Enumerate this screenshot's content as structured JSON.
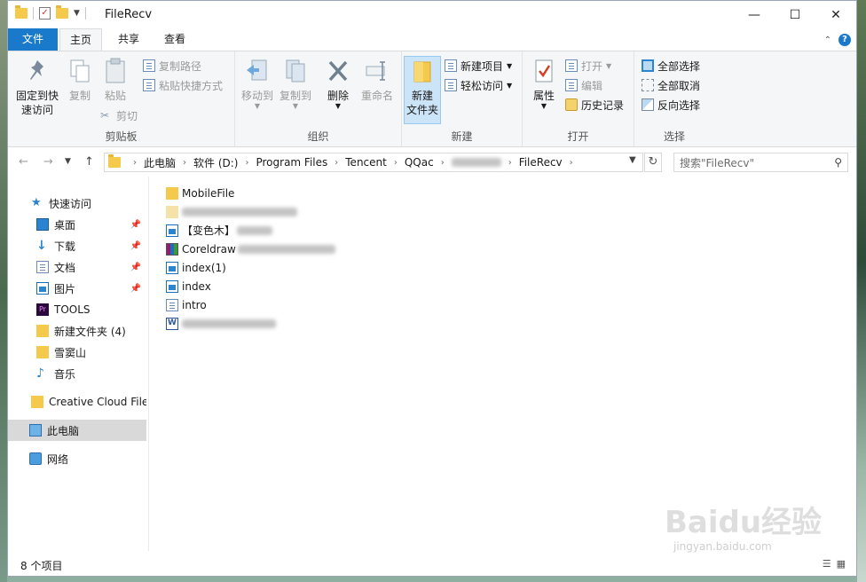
{
  "window": {
    "title": "FileRecv",
    "controls": {
      "minimize": "—",
      "maximize": "☐",
      "close": "✕"
    }
  },
  "ribbon_tabs": [
    "文件",
    "主页",
    "共享",
    "查看"
  ],
  "ribbon": {
    "clipboard": {
      "label": "剪贴板",
      "pin": "固定到快速访问",
      "pin_line1": "固定到快",
      "pin_line2": "速访问",
      "copy": "复制",
      "paste": "粘贴",
      "copy_path": "复制路径",
      "paste_shortcut": "粘贴快捷方式",
      "cut": "剪切"
    },
    "organize": {
      "label": "组织",
      "move_to": "移动到",
      "copy_to": "复制到",
      "delete": "删除",
      "rename": "重命名"
    },
    "new": {
      "label": "新建",
      "new_folder_line1": "新建",
      "new_folder_line2": "文件夹",
      "new_item": "新建项目",
      "easy_access": "轻松访问"
    },
    "open": {
      "label": "打开",
      "properties": "属性",
      "open": "打开",
      "edit": "编辑",
      "history": "历史记录"
    },
    "select": {
      "label": "选择",
      "select_all": "全部选择",
      "select_none": "全部取消",
      "invert": "反向选择"
    }
  },
  "address": {
    "crumbs": [
      "此电脑",
      "软件 (D:)",
      "Program Files",
      "Tencent",
      "QQac",
      "",
      "FileRecv"
    ],
    "search_placeholder": "搜索\"FileRecv\""
  },
  "nav_pane": {
    "quick_access": "快速访问",
    "items": [
      {
        "label": "桌面",
        "icon": "desktop-icon",
        "pinned": true
      },
      {
        "label": "下载",
        "icon": "download-icon",
        "pinned": true
      },
      {
        "label": "文档",
        "icon": "documents-icon",
        "pinned": true
      },
      {
        "label": "图片",
        "icon": "pictures-icon",
        "pinned": true
      },
      {
        "label": "TOOLS",
        "icon": "premiere-icon",
        "pinned": false
      },
      {
        "label": "新建文件夹 (4)",
        "icon": "folder-icon",
        "pinned": false
      },
      {
        "label": "雪窦山",
        "icon": "folder-icon",
        "pinned": false
      },
      {
        "label": "音乐",
        "icon": "music-icon",
        "pinned": false
      }
    ],
    "creative_cloud": "Creative Cloud Files",
    "this_pc": "此电脑",
    "network": "网络"
  },
  "files": [
    {
      "name": "MobileFile",
      "type": "folder",
      "blur_width": 0
    },
    {
      "name": "",
      "type": "folder",
      "blur_width": 130
    },
    {
      "name": "【变色木】",
      "type": "image",
      "blur_width": 40
    },
    {
      "name": "Coreldraw",
      "type": "archive",
      "blur_width": 110
    },
    {
      "name": "index(1)",
      "type": "image",
      "blur_width": 0
    },
    {
      "name": "index",
      "type": "image",
      "blur_width": 0
    },
    {
      "name": "intro",
      "type": "document",
      "blur_width": 0
    },
    {
      "name": "",
      "type": "word",
      "blur_width": 106
    }
  ],
  "status": {
    "item_count": "8 个项目"
  },
  "watermark": {
    "main": "Baidu经验",
    "sub": "jingyan.baidu.com"
  },
  "colors": {
    "accent": "#1979ca",
    "folder": "#f5c94b",
    "selected": "#d9d9d9"
  }
}
